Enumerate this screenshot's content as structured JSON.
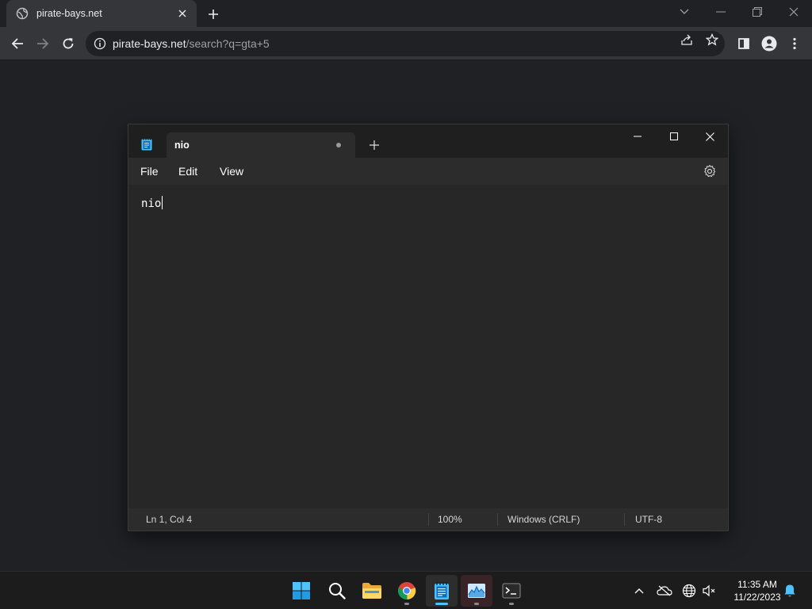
{
  "browser": {
    "tab_title": "pirate-bays.net",
    "url_host": "pirate-bays.net",
    "url_path": "/search?q=gta+5"
  },
  "notepad": {
    "tab_title": "nio",
    "menu": [
      "File",
      "Edit",
      "View"
    ],
    "content": "nio",
    "status": {
      "position": "Ln 1, Col 4",
      "zoom": "100%",
      "line_ending": "Windows (CRLF)",
      "encoding": "UTF-8"
    }
  },
  "taskbar": {
    "apps": [
      "start",
      "search",
      "file-explorer",
      "chrome",
      "notepad",
      "task-manager",
      "terminal"
    ],
    "time": "11:35 AM",
    "date": "11/22/2023"
  },
  "colors": {
    "browser_bg": "#202124",
    "toolbar": "#35363a",
    "notepad_bg": "#272727",
    "accent": "#4cc2ff"
  }
}
